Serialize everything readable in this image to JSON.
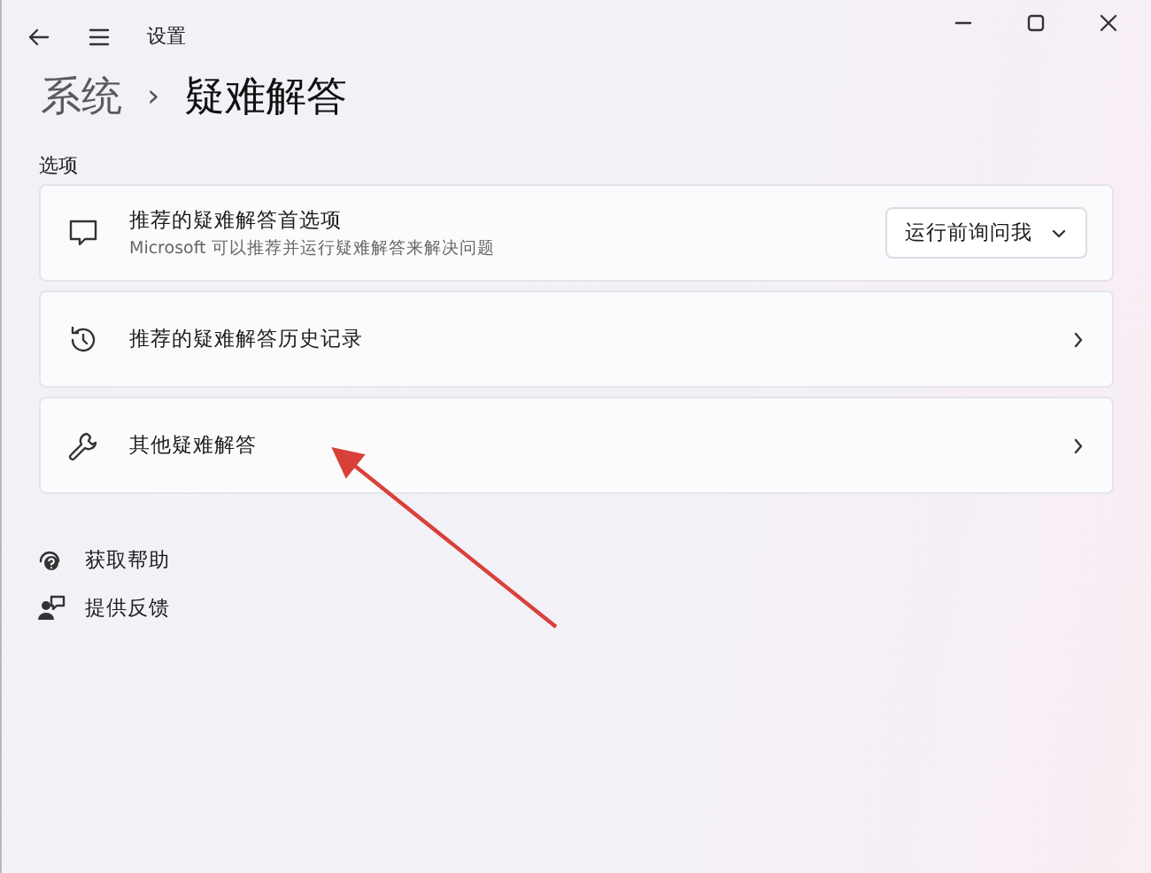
{
  "window": {
    "title": "设置"
  },
  "breadcrumb": {
    "parent": "系统",
    "separator": "›",
    "current": "疑难解答"
  },
  "section_label": "选项",
  "cards": [
    {
      "kind": "dropdown",
      "title": "推荐的疑难解答首选项",
      "subtitle": "Microsoft 可以推荐并运行疑难解答来解决问题",
      "value": "运行前询问我"
    },
    {
      "kind": "link",
      "title": "推荐的疑难解答历史记录"
    },
    {
      "kind": "link",
      "title": "其他疑难解答"
    }
  ],
  "links": [
    "获取帮助",
    "提供反馈"
  ]
}
